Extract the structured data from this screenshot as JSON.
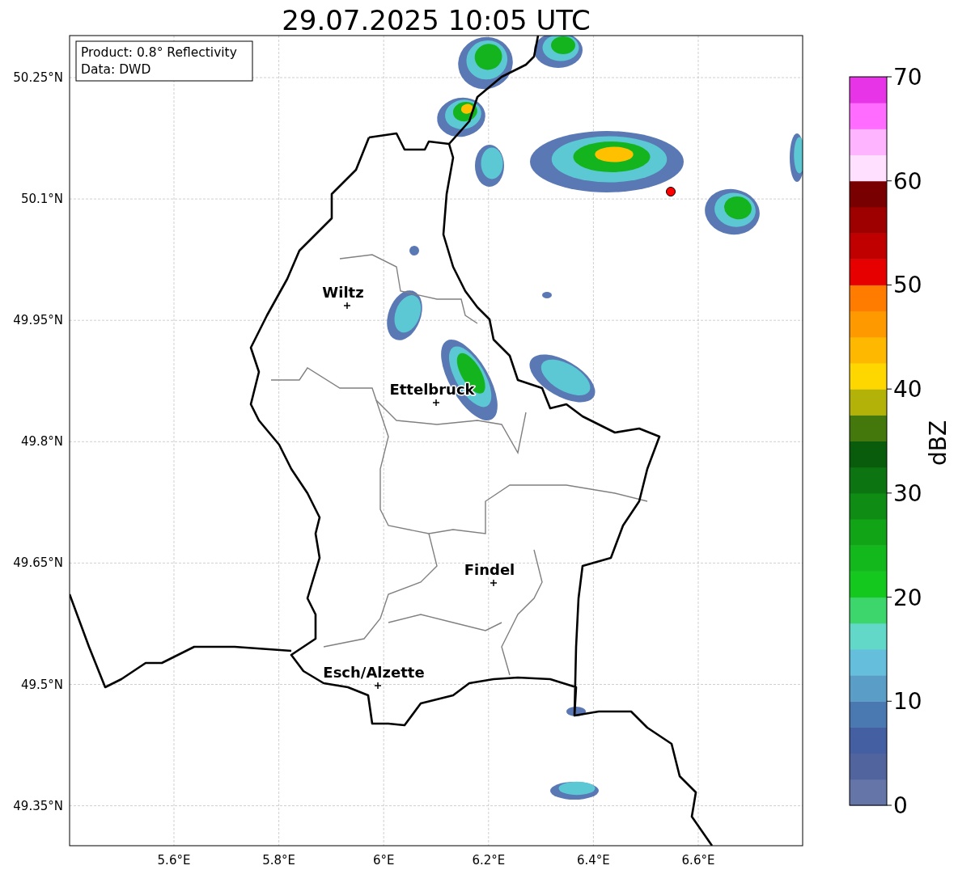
{
  "title": "29.07.2025 10:05 UTC",
  "info_box": [
    "Product: 0.8° Reflectivity",
    "Data: DWD"
  ],
  "map": {
    "lat_labels": [
      "50.25°N",
      "50.1°N",
      "49.95°N",
      "49.8°N",
      "49.65°N",
      "49.5°N",
      "49.35°N"
    ],
    "lon_labels": [
      "5.6°E",
      "5.8°E",
      "6°E",
      "6.2°E",
      "6.4°E",
      "6.6°E"
    ],
    "cities": [
      {
        "name": "Wiltz"
      },
      {
        "name": "Ettelbruck"
      },
      {
        "name": "Findel"
      },
      {
        "name": "Esch/Alzette"
      }
    ]
  },
  "colorbar": {
    "label": "dBZ",
    "ticks": [
      "70",
      "60",
      "50",
      "40",
      "30",
      "20",
      "10",
      "0"
    ],
    "bins": [
      {
        "color": "#6575a8"
      },
      {
        "color": "#52649e"
      },
      {
        "color": "#4460a3"
      },
      {
        "color": "#4a78b0"
      },
      {
        "color": "#5a9ec8"
      },
      {
        "color": "#64bedc"
      },
      {
        "color": "#62d8c8"
      },
      {
        "color": "#3dd66c"
      },
      {
        "color": "#14c81e"
      },
      {
        "color": "#12b81c"
      },
      {
        "color": "#10a416"
      },
      {
        "color": "#0e8c14"
      },
      {
        "color": "#0c7410"
      },
      {
        "color": "#085c0c"
      },
      {
        "color": "#44780c"
      },
      {
        "color": "#b2b208"
      },
      {
        "color": "#ffd700"
      },
      {
        "color": "#ffb800"
      },
      {
        "color": "#ff9900"
      },
      {
        "color": "#ff7c00"
      },
      {
        "color": "#e60000"
      },
      {
        "color": "#c00000"
      },
      {
        "color": "#9e0000"
      },
      {
        "color": "#780000"
      },
      {
        "color": "#ffe0ff"
      },
      {
        "color": "#ffb4ff"
      },
      {
        "color": "#ff6cff"
      },
      {
        "color": "#e634e6"
      }
    ]
  }
}
